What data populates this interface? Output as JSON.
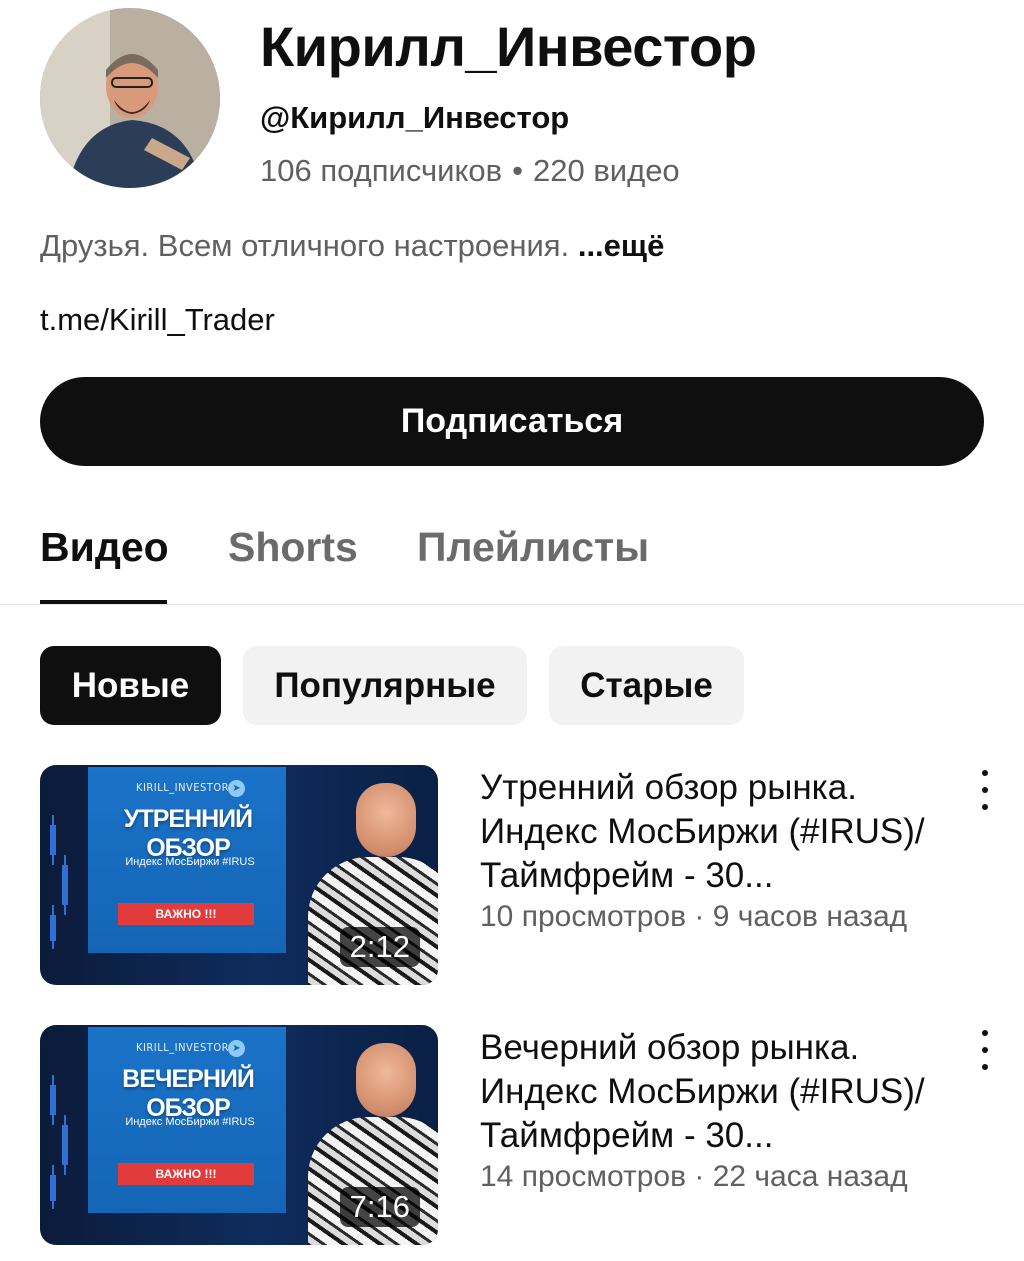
{
  "channel": {
    "name": "Кирилл_Инвестор",
    "handle": "@Кирилл_Инвестор",
    "subscribers": "106 подписчиков",
    "separator": "•",
    "videos_count": "220 видео",
    "description": "Друзья. Всем отличного настроения.",
    "more_label": "...ещё",
    "link": "t.me/Kirill_Trader"
  },
  "subscribe_label": "Подписаться",
  "tabs": [
    {
      "label": "Видео",
      "active": true
    },
    {
      "label": "Shorts",
      "active": false
    },
    {
      "label": "Плейлисты",
      "active": false
    }
  ],
  "chips": [
    {
      "label": "Новые",
      "selected": true
    },
    {
      "label": "Популярные",
      "selected": false
    },
    {
      "label": "Старые",
      "selected": false
    }
  ],
  "videos": [
    {
      "title": "Утренний обзор рынка. Индекс МосБиржи (#IRUS)/Таймфрейм - 30...",
      "views": "10 просмотров",
      "meta_separator": "·",
      "age": "9 часов назад",
      "duration": "2:12",
      "thumbnail": {
        "brand": "KIRILL_INVESTOR",
        "headline": "УТРЕННИЙ ОБЗОР",
        "subtitle": "Индекс МосБиржи #IRUS",
        "badge": "ВАЖНО !!!"
      }
    },
    {
      "title": "Вечерний обзор рынка. Индекс МосБиржи (#IRUS)/Таймфрейм - 30...",
      "views": "14 просмотров",
      "meta_separator": "·",
      "age": "22 часа назад",
      "duration": "7:16",
      "thumbnail": {
        "brand": "KIRILL_INVESTOR",
        "headline": "ВЕЧЕРНИЙ ОБЗОР",
        "subtitle": "Индекс МосБиржи #IRUS",
        "badge": "ВАЖНО !!!"
      }
    }
  ],
  "colors": {
    "primary_text": "#0f0f0f",
    "secondary_text": "#606060",
    "subscribe_bg": "#0f0f0f",
    "chip_bg": "#f2f2f2",
    "thumbnail_accent": "#1565b5",
    "badge_red": "#e23b3b"
  }
}
